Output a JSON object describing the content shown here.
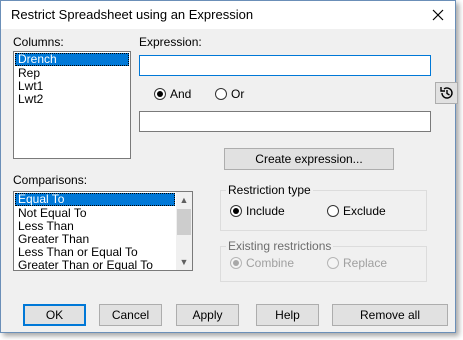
{
  "window": {
    "title": "Restrict Spreadsheet using an Expression"
  },
  "columns": {
    "label": "Columns:",
    "items": [
      "Drench",
      "Rep",
      "Lwt1",
      "Lwt2"
    ],
    "selected": "Drench"
  },
  "expression": {
    "label": "Expression:",
    "value": "",
    "second_value": ""
  },
  "logic": {
    "and_label": "And",
    "or_label": "Or",
    "selected": "And"
  },
  "history_button": {
    "icon": "history-icon"
  },
  "create_button": {
    "label": "Create expression..."
  },
  "comparisons": {
    "label": "Comparisons:",
    "items": [
      "Equal To",
      "Not Equal To",
      "Less Than",
      "Greater Than",
      "Less Than or Equal To",
      "Greater Than or Equal To"
    ],
    "selected": "Equal To"
  },
  "restriction_type": {
    "label": "Restriction type",
    "include_label": "Include",
    "exclude_label": "Exclude",
    "selected": "Include"
  },
  "existing_restrictions": {
    "label": "Existing restrictions",
    "combine_label": "Combine",
    "replace_label": "Replace",
    "selected": "Combine",
    "enabled": false
  },
  "buttons": {
    "ok": "OK",
    "cancel": "Cancel",
    "apply": "Apply",
    "help": "Help",
    "remove_all": "Remove all"
  },
  "colors": {
    "selection": "#0078d7",
    "window_bg": "#f0f0f0",
    "border": "#6b8fb8"
  }
}
